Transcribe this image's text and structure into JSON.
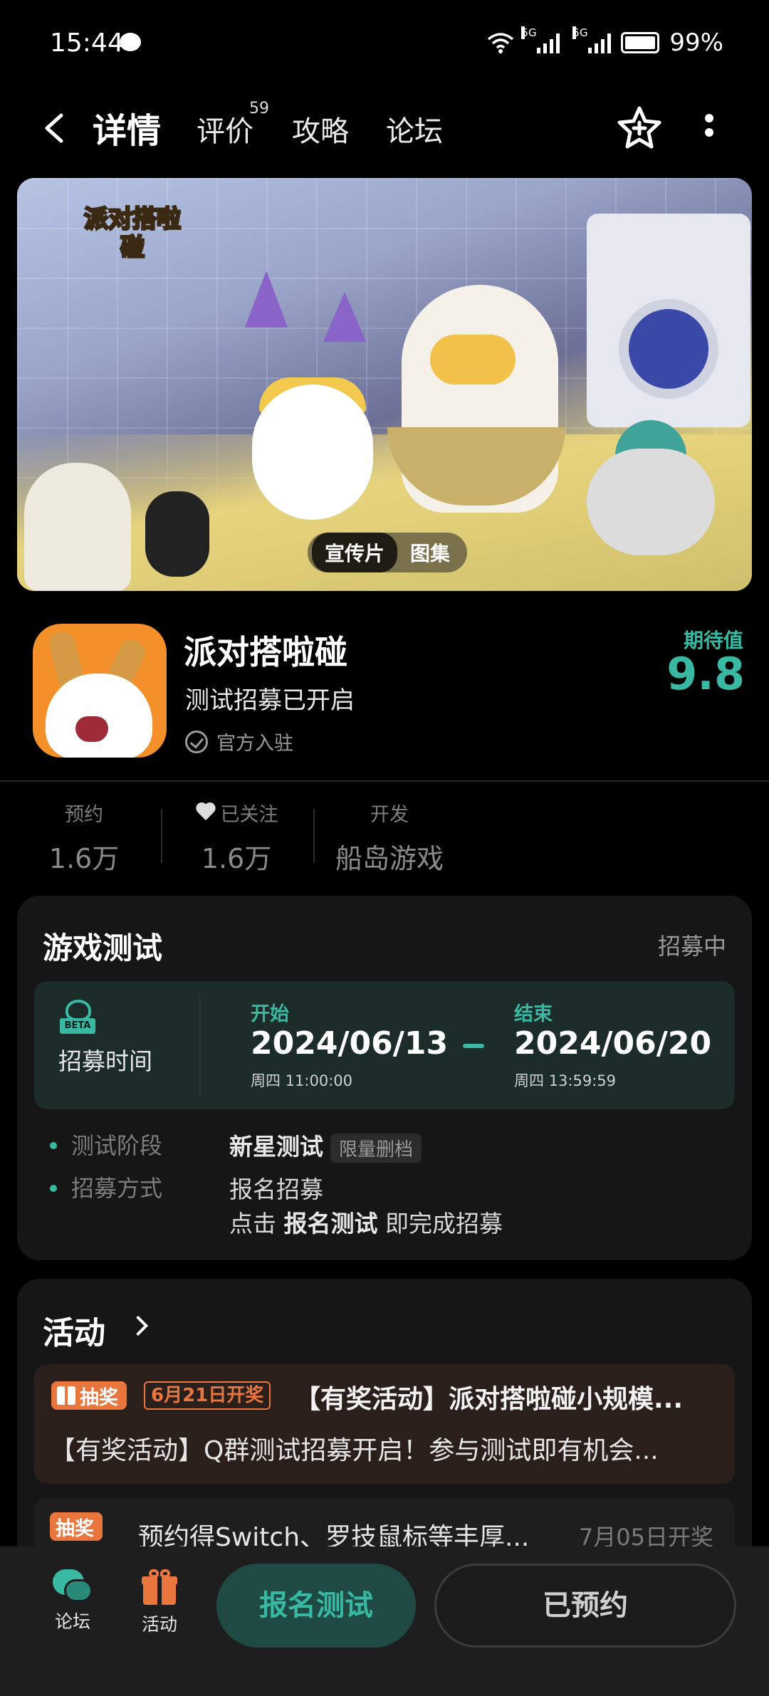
{
  "status_bar": {
    "time": "15:44",
    "network_1": "5G",
    "network_2": "5G",
    "battery": "99%"
  },
  "header": {
    "tabs": [
      {
        "label": "详情",
        "active": true
      },
      {
        "label": "评价",
        "badge": "59"
      },
      {
        "label": "攻略"
      },
      {
        "label": "论坛"
      }
    ]
  },
  "banner": {
    "logo_text": "派对搭啦碰",
    "media_tabs": [
      "宣传片",
      "图集"
    ]
  },
  "game": {
    "name": "派对搭啦碰",
    "status": "测试招募已开启",
    "official": "官方入驻",
    "expect_label": "期待值",
    "expect_value": "9.8"
  },
  "stats": [
    {
      "label": "预约",
      "value": "1.6万"
    },
    {
      "label": "已关注",
      "value": "1.6万"
    },
    {
      "label": "开发",
      "value": "船岛游戏"
    }
  ],
  "test": {
    "title": "游戏测试",
    "status": "招募中",
    "beta_tag": "BETA",
    "recruit_label": "招募时间",
    "start_label": "开始",
    "start_date": "2024/06/13",
    "start_sub": "周四  11:00:00",
    "end_label": "结束",
    "end_date": "2024/06/20",
    "end_sub": "周四  13:59:59",
    "stage_key": "测试阶段",
    "stage_val": "新星测试",
    "stage_chip": "限量删档",
    "method_key": "招募方式",
    "method_val": "报名招募",
    "method_note_prefix": "点击 ",
    "method_note_bold": "报名测试",
    "method_note_suffix": " 即完成招募"
  },
  "activity": {
    "title": "活动",
    "items": [
      {
        "badge": "抽奖",
        "date_tag": "6月21日开奖",
        "headline": "【有奖活动】派对搭啦碰小规模...",
        "desc": "【有奖活动】Q群测试招募开启！参与测试即有机会..."
      },
      {
        "badge": "抽奖",
        "text": "预约得Switch、罗技鼠标等丰厚...",
        "date": "7月05日开奖"
      }
    ]
  },
  "bottom_bar": {
    "forum_label": "论坛",
    "activity_label": "活动",
    "signup_label": "报名测试",
    "reserved_label": "已预约"
  },
  "colors": {
    "accent": "#39b9a3",
    "lottery": "#e9763c",
    "background": "#000000"
  }
}
